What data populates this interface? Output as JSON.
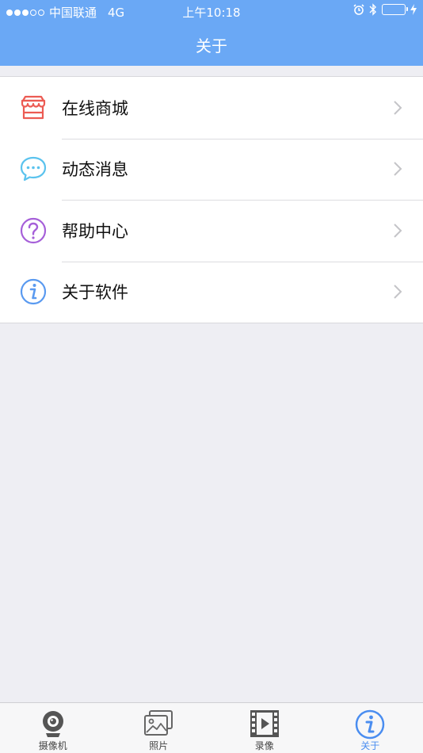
{
  "status": {
    "carrier": "中国联通",
    "network": "4G",
    "time": "上午10:18"
  },
  "header": {
    "title": "关于"
  },
  "menu": [
    {
      "label": "在线商城",
      "icon": "store-icon",
      "color": "#ec5b53"
    },
    {
      "label": "动态消息",
      "icon": "message-bubble-icon",
      "color": "#5bc3ee"
    },
    {
      "label": "帮助中心",
      "icon": "help-question-icon",
      "color": "#a660d9"
    },
    {
      "label": "关于软件",
      "icon": "info-icon",
      "color": "#5a9af0"
    }
  ],
  "tabs": [
    {
      "label": "摄像机",
      "icon": "camera-icon"
    },
    {
      "label": "照片",
      "icon": "photos-icon"
    },
    {
      "label": "录像",
      "icon": "video-icon"
    },
    {
      "label": "关于",
      "icon": "info-icon",
      "active": true
    }
  ],
  "colors": {
    "header": "#6aa8f5",
    "background": "#eeeef3",
    "active_tab": "#4a8df0"
  }
}
